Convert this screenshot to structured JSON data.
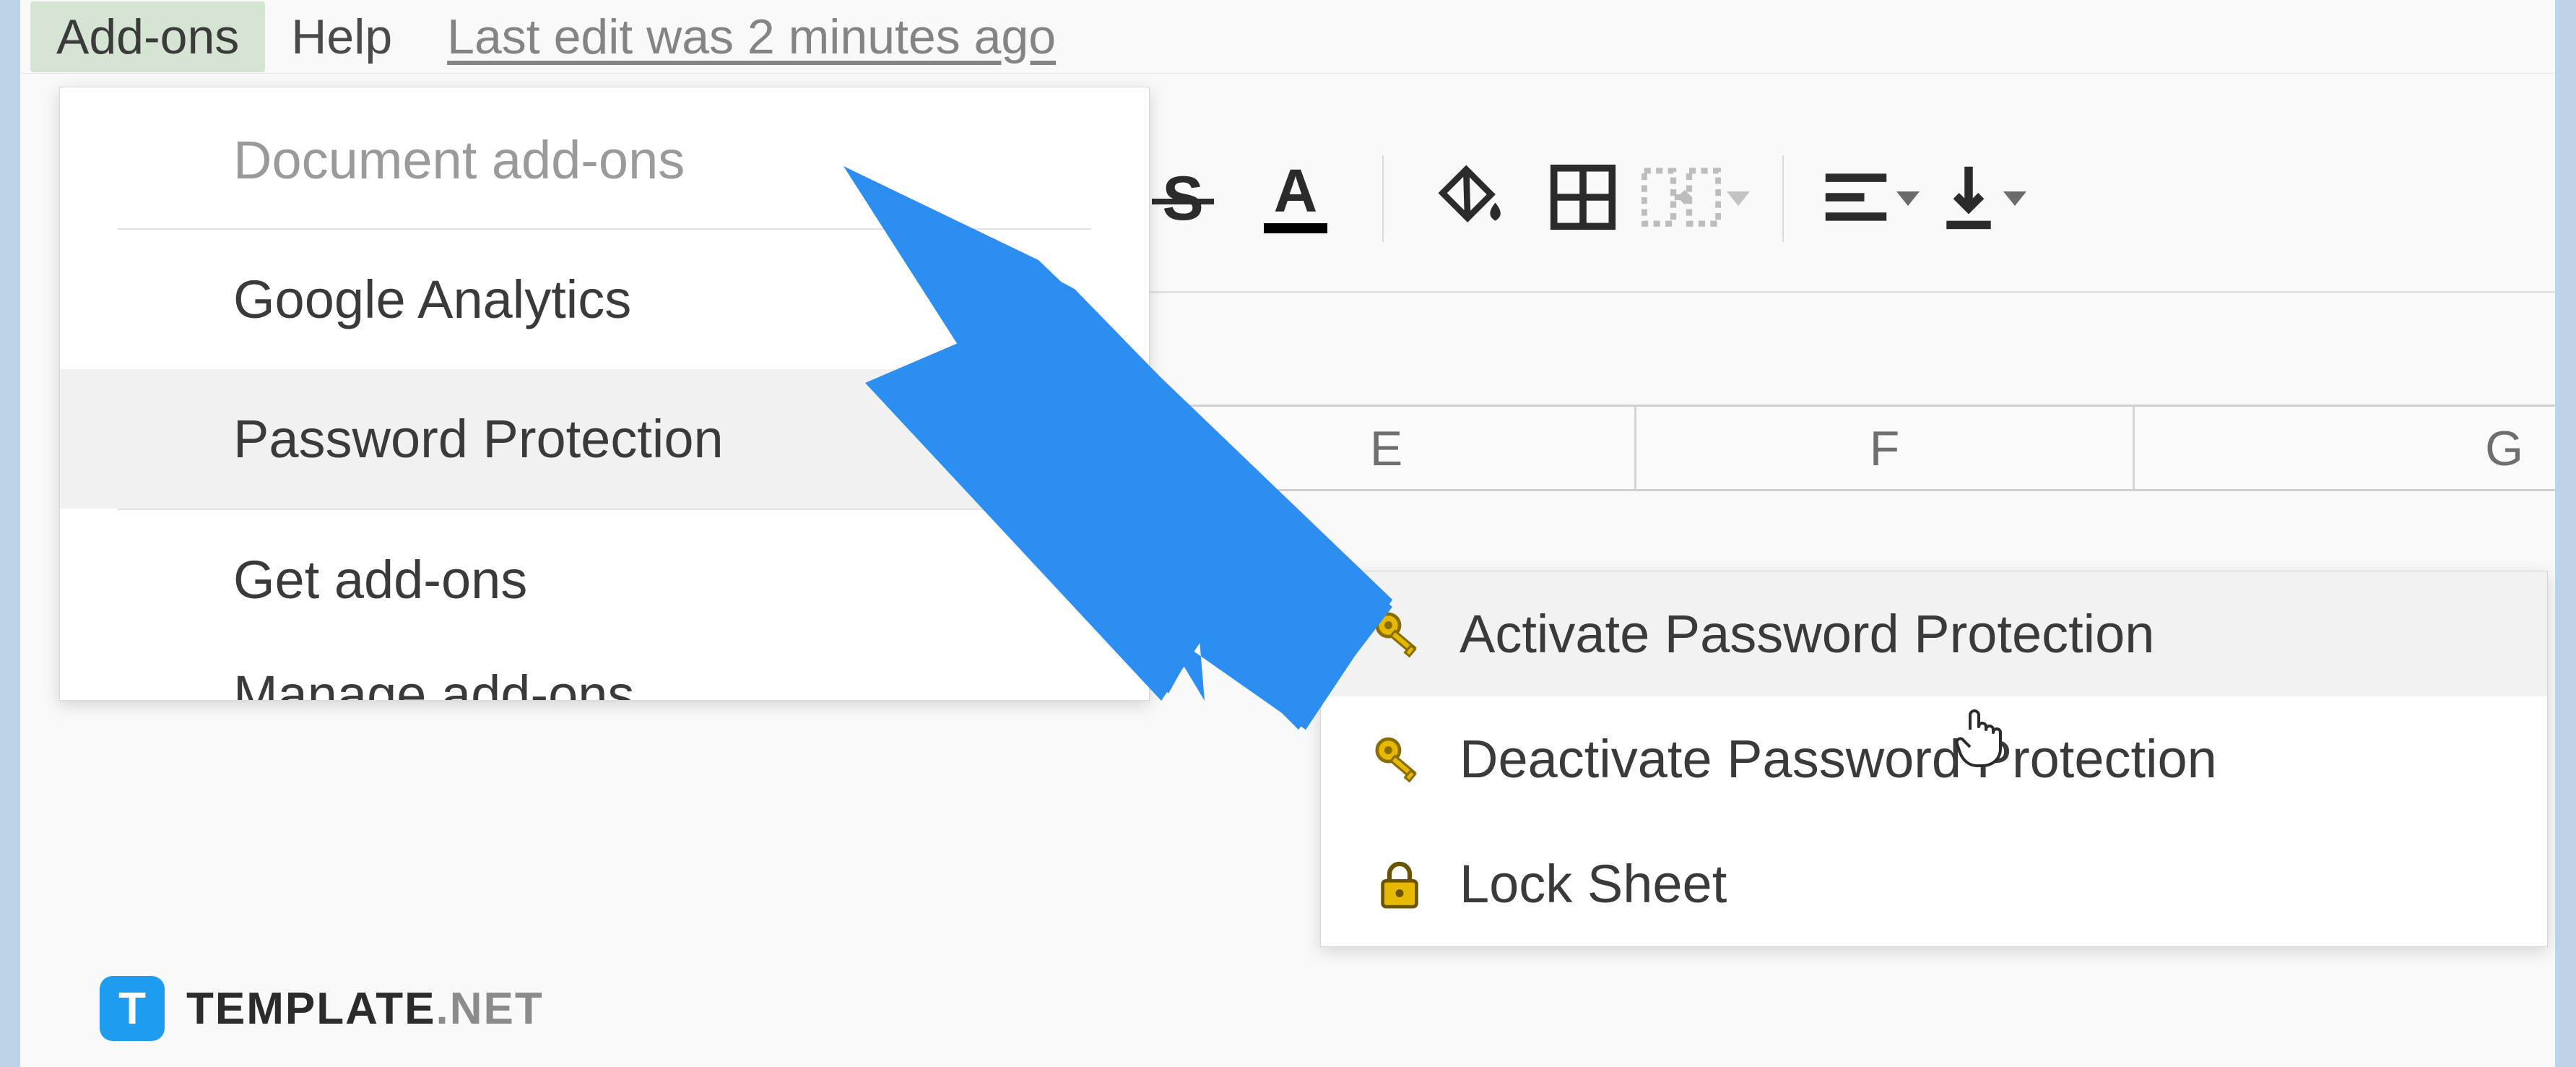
{
  "menubar": {
    "addons": "Add-ons",
    "help": "Help",
    "last_edit": "Last edit was 2 minutes ago"
  },
  "toolbar": {
    "strike": "S",
    "textcolor_glyph": "A"
  },
  "columns": {
    "e": "E",
    "f": "F",
    "g": "G"
  },
  "dropdown": {
    "header": "Document add-ons",
    "google_analytics": "Google Analytics",
    "password_protection": "Password Protection",
    "get_addons": "Get add-ons",
    "manage_addons_cut": "Manage add-ons"
  },
  "submenu": {
    "activate": "Activate Password Protection",
    "deactivate": "Deactivate Password Protection",
    "lock": "Lock Sheet"
  },
  "watermark": {
    "badge": "T",
    "brand": "TEMPLATE",
    "suffix": ".NET"
  }
}
